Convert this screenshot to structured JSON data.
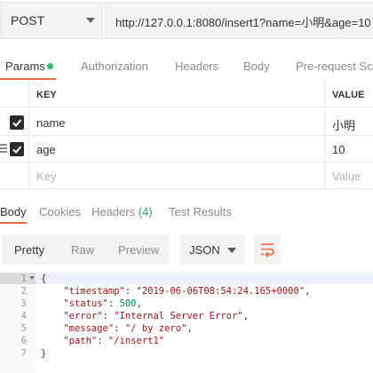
{
  "request": {
    "method": "POST",
    "url": "http://127.0.0.1:8080/insert1?name=小明&age=10"
  },
  "request_tabs": [
    {
      "label": "Params",
      "active": true,
      "status_dot_color": "#2fbf71"
    },
    {
      "label": "Authorization"
    },
    {
      "label": "Headers"
    },
    {
      "label": "Body"
    },
    {
      "label": "Pre-request Scri"
    }
  ],
  "params_table": {
    "headers": {
      "key": "KEY",
      "value": "VALUE"
    },
    "rows": [
      {
        "key": "name",
        "value": "小明",
        "checked": true
      },
      {
        "key": "age",
        "value": "10",
        "checked": true
      }
    ],
    "placeholder": {
      "key": "Key",
      "value": "Value"
    }
  },
  "response_tabs": {
    "body": "Body",
    "cookies": "Cookies",
    "headers": "Headers",
    "headers_count": "(4)",
    "test_results": "Test Results"
  },
  "view_modes": {
    "pretty": "Pretty",
    "raw": "Raw",
    "preview": "Preview",
    "active": "Pretty"
  },
  "format": {
    "selected": "JSON"
  },
  "response_body": {
    "lines": [
      {
        "n": "1",
        "text": "{"
      },
      {
        "n": "2",
        "key": "\"timestamp\"",
        "value": "\"2019-06-06T08:54:24.165+0000\"",
        "kind": "str",
        "trail": ","
      },
      {
        "n": "3",
        "key": "\"status\"",
        "value": "500",
        "kind": "num",
        "trail": ","
      },
      {
        "n": "4",
        "key": "\"error\"",
        "value": "\"Internal Server Error\"",
        "kind": "str",
        "trail": ","
      },
      {
        "n": "5",
        "key": "\"message\"",
        "value": "\"/ by zero\"",
        "kind": "str",
        "trail": ","
      },
      {
        "n": "6",
        "key": "\"path\"",
        "value": "\"/insert1\"",
        "kind": "str",
        "trail": ""
      },
      {
        "n": "7",
        "text": "}"
      }
    ]
  },
  "colors": {
    "accent": "#f26b3a",
    "success": "#2fa36b"
  },
  "icons": [
    "chevron-down-icon",
    "checkbox-checked-icon",
    "drag-handle-icon",
    "wrap-lines-icon",
    "fold-caret-icon"
  ]
}
